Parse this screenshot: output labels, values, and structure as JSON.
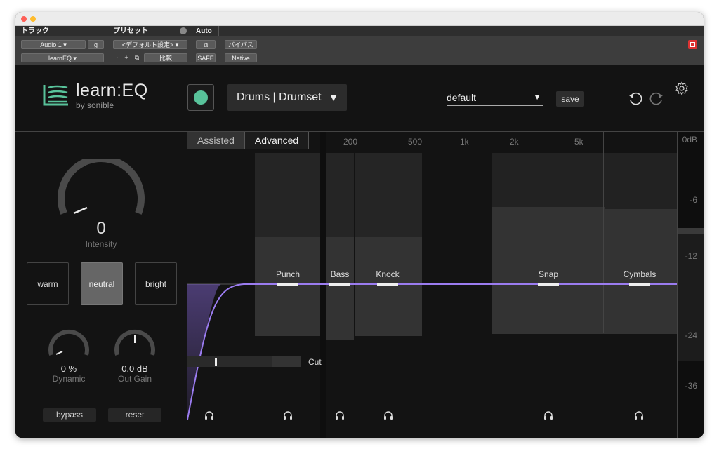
{
  "protools": {
    "track_header": "トラック",
    "preset_header": "プリセット",
    "auto_header": "Auto",
    "track_name": "Audio 1",
    "group_label": "g",
    "insert_name": "learnEQ",
    "preset_value": "<デフォルト設定>",
    "minus": "-",
    "plus": "+",
    "compare": "比較",
    "safe": "SAFE",
    "bypass": "バイパス",
    "native": "Native"
  },
  "logo": {
    "name": "learn:EQ",
    "by": "by sonible"
  },
  "header": {
    "profile": "Drums | Drumset",
    "preset": "default",
    "save": "save"
  },
  "left": {
    "intensity_value": "0",
    "intensity_label": "Intensity",
    "intensity_level": 0,
    "tones": [
      "warm",
      "neutral",
      "bright"
    ],
    "selected_tone": "neutral",
    "dynamic_value": "0 %",
    "dynamic_label": "Dynamic",
    "outgain_value": "0.0 dB",
    "outgain_label": "Out Gain",
    "bypass": "bypass",
    "reset": "reset"
  },
  "eq": {
    "tabs": [
      "Assisted",
      "Advanced"
    ],
    "active_tab": "Advanced",
    "freq_labels": [
      "200",
      "500",
      "1k",
      "2k",
      "5k"
    ],
    "bands": [
      "Punch",
      "Bass",
      "Knock",
      "Snap",
      "Cymbals"
    ],
    "cut_label": "Cut",
    "curve_color": "#8f6ee6"
  },
  "meter": {
    "labels": [
      "0dB",
      "-6",
      "-12",
      "-24",
      "-36"
    ]
  },
  "colors": {
    "accent": "#58c29a",
    "curve": "#8f6ee6"
  }
}
